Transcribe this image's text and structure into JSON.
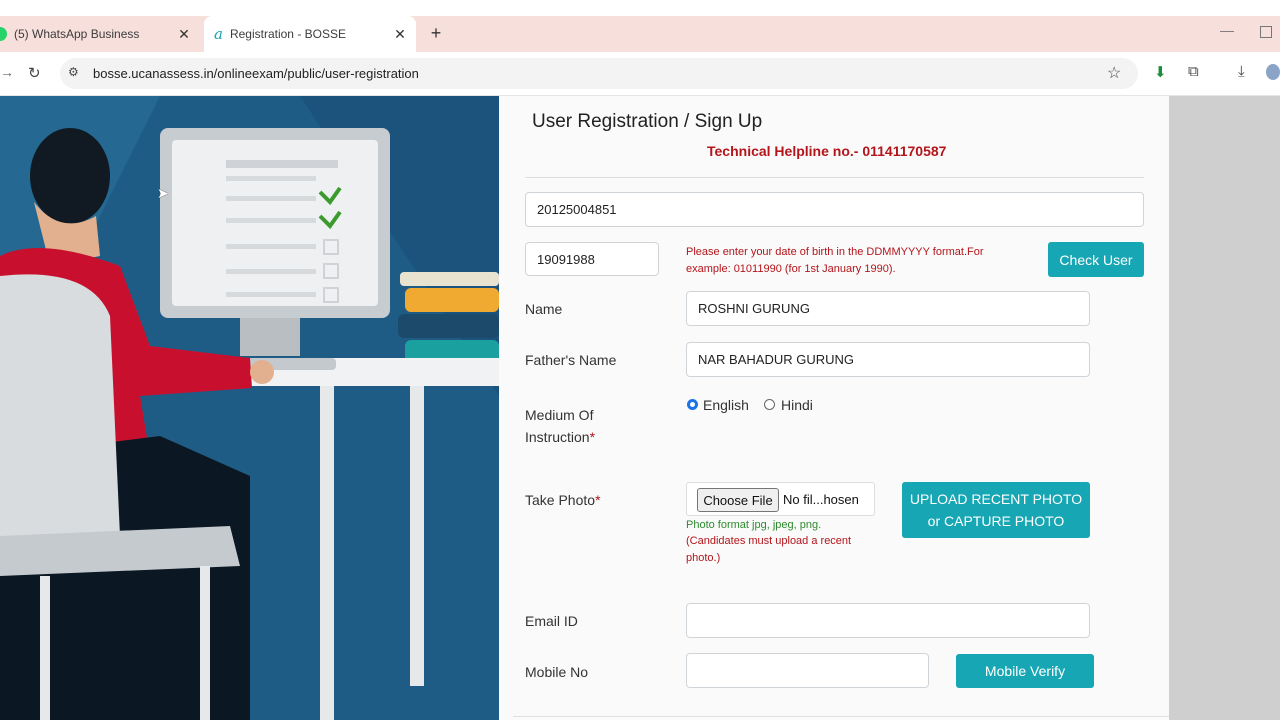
{
  "browser": {
    "tabs": [
      {
        "label": "(5) WhatsApp Business",
        "active": false
      },
      {
        "label": "Registration - BOSSE",
        "active": true
      }
    ],
    "url": "bosse.ucanassess.in/onlineexam/public/user-registration"
  },
  "form": {
    "title": "User Registration / Sign Up",
    "helpline": "Technical Helpline no.- 01141170587",
    "registration_number": "20125004851",
    "dob_value": "19091988",
    "dob_hint": "Please enter your date of birth in the DDMMYYYY format.For example: 01011990 (for 1st January 1990).",
    "check_user_label": "Check User",
    "name_label": "Name",
    "name_value": "ROSHNI GURUNG",
    "father_label": "Father's Name",
    "father_value": "NAR BAHADUR GURUNG",
    "medium_label_1": "Medium Of",
    "medium_label_2": "Instruction",
    "required_mark": "*",
    "medium_options": [
      {
        "label": "English",
        "selected": true
      },
      {
        "label": "Hindi",
        "selected": false
      }
    ],
    "photo_label": "Take Photo",
    "choose_file_label": "Choose File",
    "no_file_text": "No fil...hosen",
    "photo_format": "Photo format jpg, jpeg, png.",
    "photo_note": "(Candidates must upload a recent photo.)",
    "upload_btn_line1": "UPLOAD RECENT PHOTO",
    "upload_btn_line2": "or CAPTURE PHOTO",
    "email_label": "Email ID",
    "email_value": "",
    "mobile_label": "Mobile No",
    "mobile_value": "",
    "mobile_verify_label": "Mobile Verify"
  },
  "colors": {
    "accent": "#17a6b3",
    "error_red": "#b3151b",
    "hero_bg": "#1f5c85"
  }
}
